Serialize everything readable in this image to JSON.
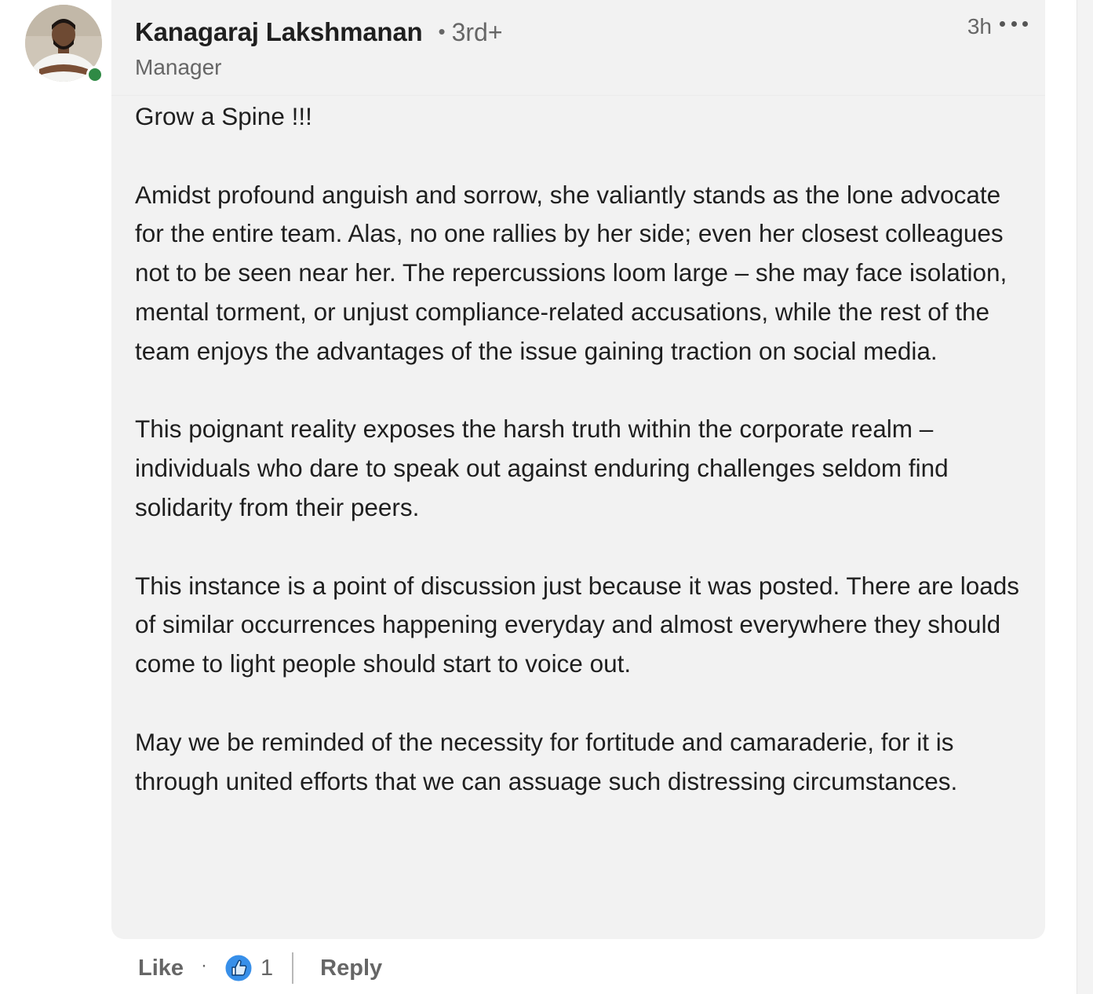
{
  "comment": {
    "author": {
      "name": "Kanagaraj Lakshmanan",
      "degree_separator": "•",
      "degree": "3rd+",
      "headline": "Manager",
      "avatar_icon": "profile-photo",
      "presence_status": "online",
      "presence_color": "#2f8a45"
    },
    "timestamp": "3h",
    "more_icon": "ellipsis-icon",
    "paragraphs": [
      "Grow a Spine !!!",
      "Amidst profound anguish and sorrow, she valiantly stands as the lone advocate for the entire team. Alas, no one rallies by her side; even her closest colleagues not to be seen near her. The repercussions loom large – she may face isolation, mental torment, or unjust compliance-related accusations, while the rest of the team enjoys the advantages of the issue gaining traction on social media.",
      "This poignant reality exposes the harsh truth within the corporate realm – individuals who dare to speak out against enduring challenges seldom find solidarity from their peers.",
      "This instance is a point of discussion just because it was posted. There are loads of similar occurrences happening everyday and almost everywhere they should come to light people should start to voice out.",
      "May we be reminded of the necessity for fortitude and camaraderie, for it is through united efforts that we can assuage such distressing circumstances."
    ]
  },
  "actions": {
    "like_label": "Like",
    "separator": "·",
    "reaction_icon": "thumbs-up-icon",
    "reaction_count": "1",
    "reply_label": "Reply",
    "reaction_color": "#378fe9"
  },
  "colors": {
    "bubble_background": "#f2f2f2",
    "text_primary": "#1f1f1f",
    "text_secondary": "#666666"
  }
}
